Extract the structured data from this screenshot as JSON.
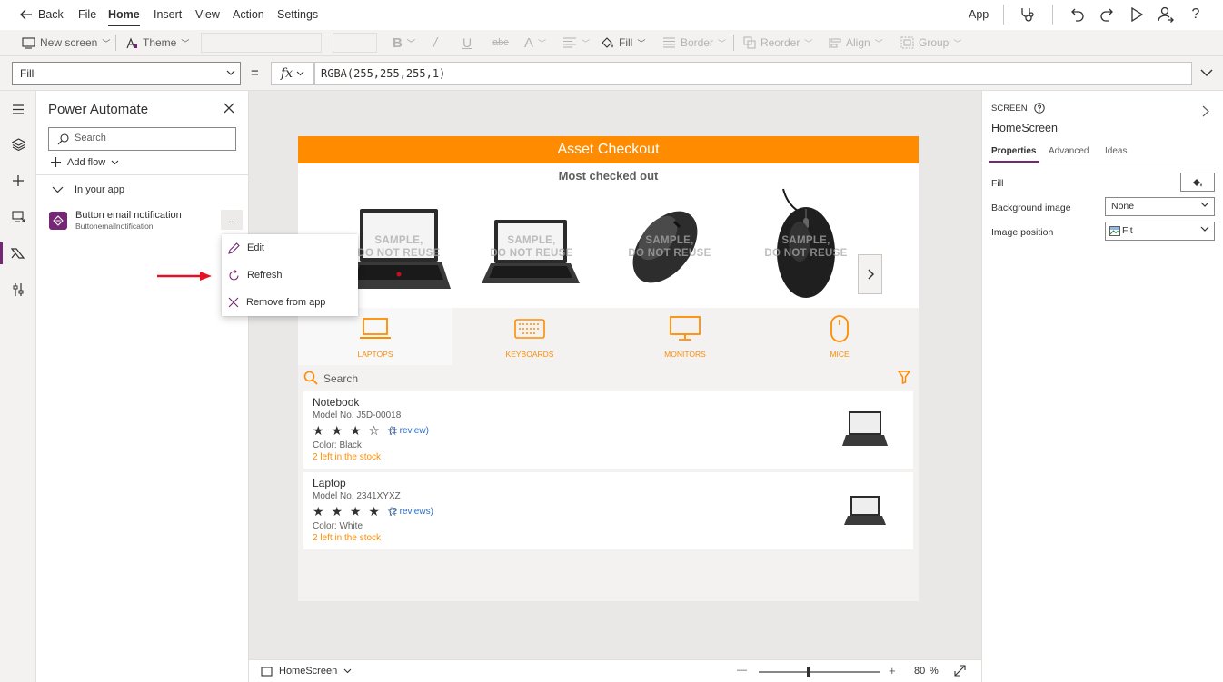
{
  "menu": {
    "back": "Back",
    "items": [
      "File",
      "Home",
      "Insert",
      "View",
      "Action",
      "Settings"
    ],
    "app": "App"
  },
  "ribbon": {
    "new_screen": "New screen",
    "theme": "Theme",
    "fill": "Fill",
    "border": "Border",
    "reorder": "Reorder",
    "align": "Align",
    "group": "Group"
  },
  "formula": {
    "property": "Fill",
    "equals": "=",
    "fx": "fx",
    "expression": "RGBA(255,255,255,1)"
  },
  "power_automate": {
    "title": "Power Automate",
    "search_placeholder": "Search",
    "add_flow": "Add flow",
    "section": "In your app",
    "flow": {
      "name": "Button email notification",
      "sub": "Buttonemailnotification",
      "more": "..."
    },
    "context_menu": [
      "Edit",
      "Refresh",
      "Remove from app"
    ]
  },
  "app": {
    "header": "Asset Checkout",
    "hero_title": "Most checked out",
    "watermark_line1": "SAMPLE,",
    "watermark_line2": "DO NOT REUSE",
    "categories": [
      "LAPTOPS",
      "KEYBOARDS",
      "MONITORS",
      "MICE"
    ],
    "search_placeholder": "Search",
    "items": [
      {
        "title": "Notebook",
        "model": "Model No. J5D-00018",
        "stars": "★ ★ ★ ☆ ☆",
        "rating": 3,
        "review": "(1 review)",
        "color": "Color: Black",
        "stock": "2 left in the stock"
      },
      {
        "title": "Laptop",
        "model": "Model No. 2341XYXZ",
        "stars": "★ ★ ★ ★ ☆",
        "rating": 4,
        "review": "(2 reviews)",
        "color": "Color: White",
        "stock": "2 left in the stock"
      }
    ]
  },
  "status": {
    "screen": "HomeScreen",
    "minus": "—",
    "plus": "+",
    "zoom": "80",
    "percent": "%"
  },
  "props": {
    "kicker": "SCREEN",
    "title": "HomeScreen",
    "tabs": [
      "Properties",
      "Advanced",
      "Ideas"
    ],
    "fill_label": "Fill",
    "bg_label": "Background image",
    "bg_value": "None",
    "pos_label": "Image position",
    "pos_value": "Fit"
  },
  "colors": {
    "accent": "#742774",
    "brand_orange": "#ff8c00",
    "arrow_red": "#e81123"
  }
}
